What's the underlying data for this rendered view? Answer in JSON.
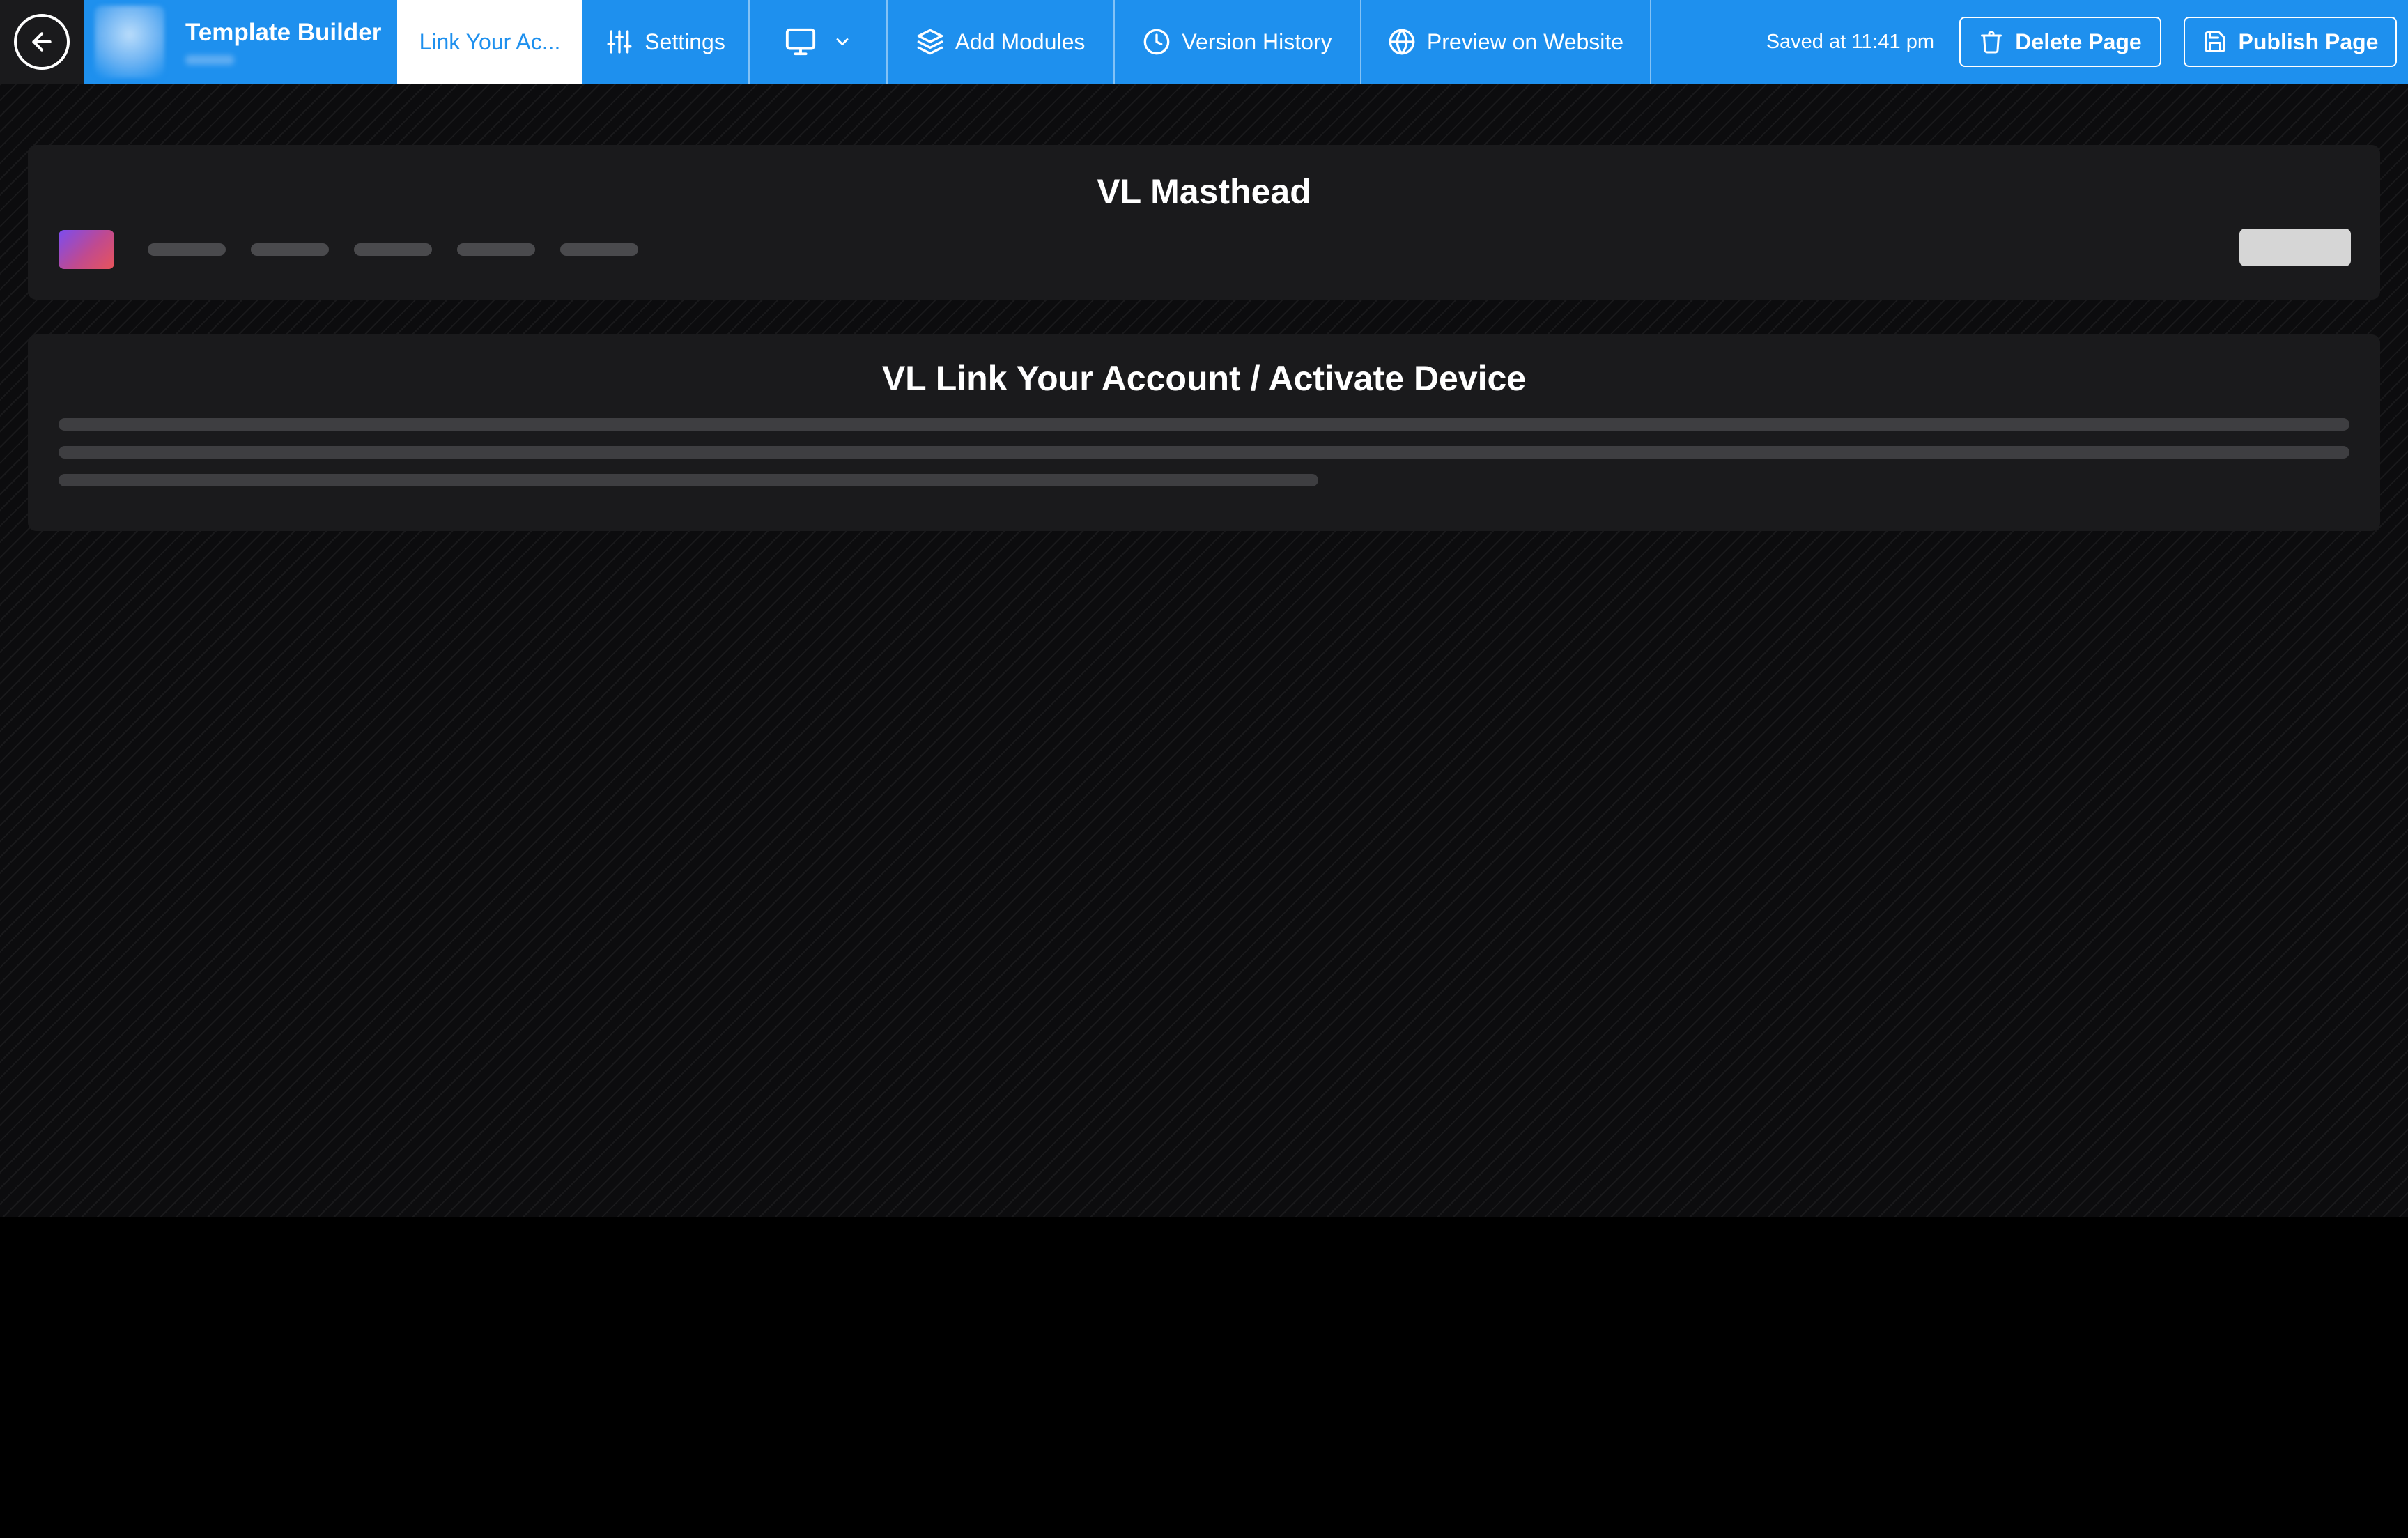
{
  "topbar": {
    "app_title": "Template Builder",
    "tabs": {
      "active_page": "Link Your Ac...",
      "settings": "Settings",
      "add_modules": "Add Modules",
      "version_history": "Version History",
      "preview": "Preview on Website"
    },
    "saved_status": "Saved at 11:41 pm",
    "delete_label": "Delete Page",
    "publish_label": "Publish Page"
  },
  "modules": [
    {
      "title": "VL Masthead"
    },
    {
      "title": "VL Link Your Account / Activate Device"
    }
  ],
  "icons": {
    "back": "arrow-left-icon",
    "settings": "sliders-icon",
    "device": "monitor-icon",
    "device_menu": "chevron-down-icon",
    "add_modules": "layers-icon",
    "version_history": "clock-icon",
    "preview": "globe-icon",
    "delete": "trash-icon",
    "publish": "save-icon"
  },
  "colors": {
    "primary": "#1e90ee",
    "canvas": "#0c0c0e",
    "module_bg": "#1a1a1c"
  }
}
